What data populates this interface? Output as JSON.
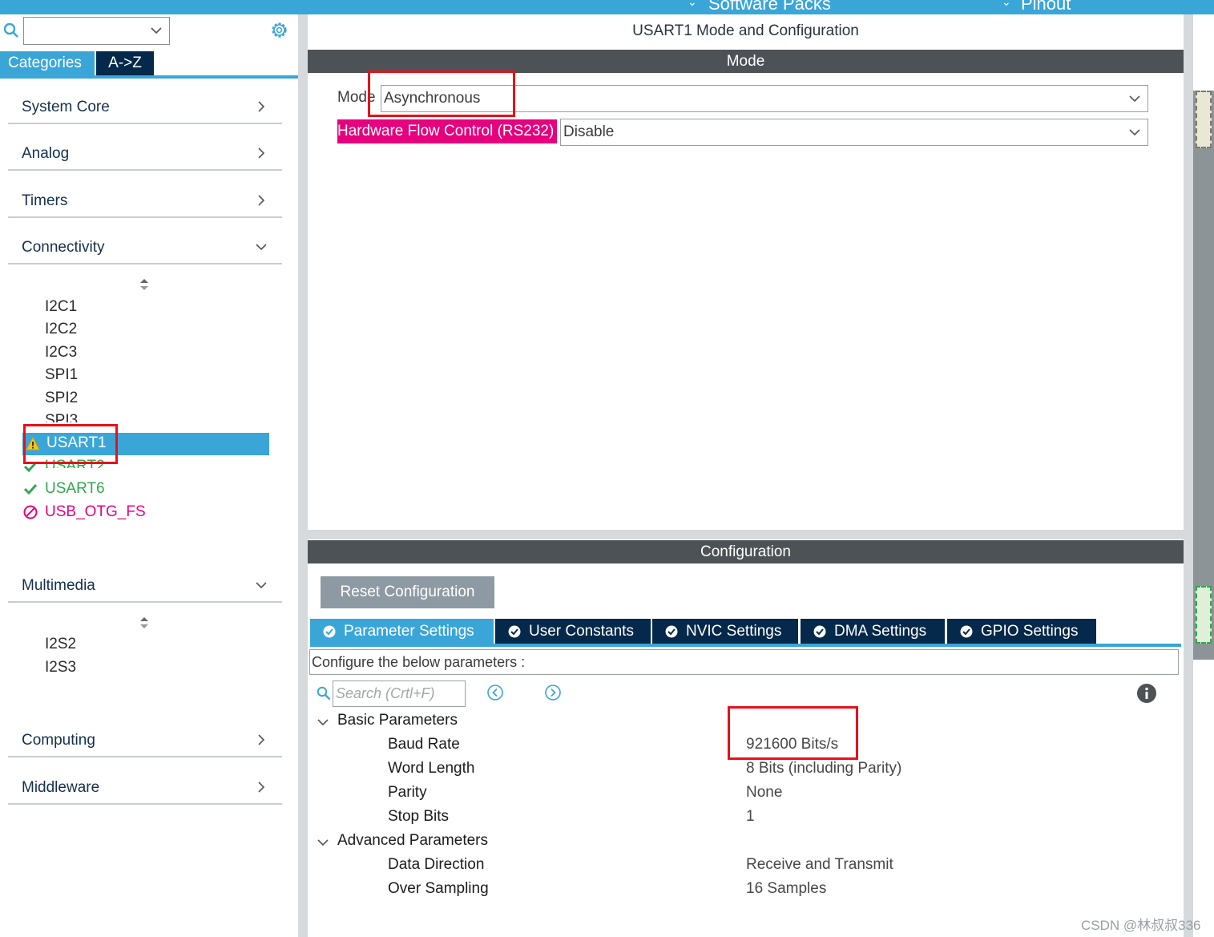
{
  "top_strip": {
    "left_text": "Software Packs",
    "right_text": "Pinout"
  },
  "sidebar": {
    "search_value": "",
    "tabs": [
      "Categories",
      "A->Z"
    ],
    "categories": [
      {
        "label": "System Core",
        "expanded": false
      },
      {
        "label": "Analog",
        "expanded": false
      },
      {
        "label": "Timers",
        "expanded": false
      },
      {
        "label": "Connectivity",
        "expanded": true
      },
      {
        "label": "Multimedia",
        "expanded": true
      },
      {
        "label": "Computing",
        "expanded": false
      },
      {
        "label": "Middleware",
        "expanded": false
      }
    ],
    "connectivity_items": [
      "I2C1",
      "I2C2",
      "I2C3",
      "SPI1",
      "SPI2",
      "SPI3"
    ],
    "selected_item": "USART1",
    "selected_status": "warning-icon",
    "status_items": [
      {
        "label": "USART2",
        "status": "check-icon"
      },
      {
        "label": "USART6",
        "status": "check-icon"
      },
      {
        "label": "USB_OTG_FS",
        "status": "disabled-icon"
      }
    ],
    "multimedia_items": [
      "I2S2",
      "I2S3"
    ]
  },
  "main": {
    "title": "USART1 Mode and Configuration",
    "mode_header": "Mode",
    "mode_label": "Mode",
    "mode_value": "Asynchronous",
    "hw_flow_label": "Hardware Flow Control (RS232)",
    "hw_flow_value": "Disable",
    "config_header": "Configuration",
    "reset_button": "Reset Configuration",
    "tabs": [
      "Parameter Settings",
      "User Constants",
      "NVIC Settings",
      "DMA Settings",
      "GPIO Settings"
    ],
    "active_tab": "Parameter Settings",
    "hint": "Configure the below parameters :",
    "search_placeholder": "Search (Crtl+F)",
    "groups": [
      {
        "name": "Basic Parameters",
        "params": [
          {
            "name": "Baud Rate",
            "value": "921600 Bits/s"
          },
          {
            "name": "Word Length",
            "value": "8 Bits (including Parity)"
          },
          {
            "name": "Parity",
            "value": "None"
          },
          {
            "name": "Stop Bits",
            "value": "1"
          }
        ]
      },
      {
        "name": "Advanced Parameters",
        "params": [
          {
            "name": "Data Direction",
            "value": "Receive and Transmit"
          },
          {
            "name": "Over Sampling",
            "value": "16 Samples"
          }
        ]
      }
    ]
  },
  "watermark": "CSDN @林叔叔336",
  "colors": {
    "accent_blue": "#3aa6d8",
    "dark_navy": "#05294a",
    "header_gray": "#4d5256",
    "highlight_pink": "#e6007e",
    "annotation_red": "#e8101a",
    "ok_green": "#2fa84f"
  }
}
